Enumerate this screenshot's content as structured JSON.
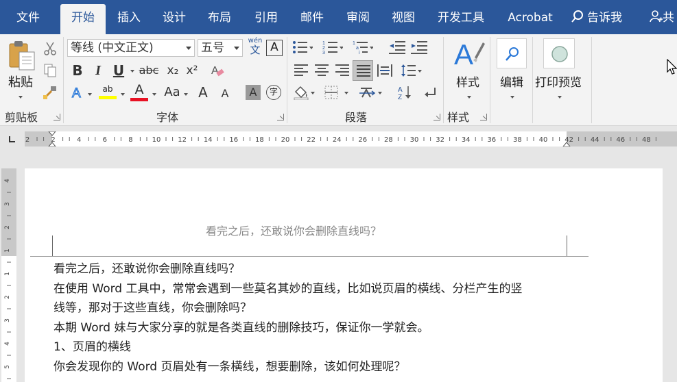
{
  "tabs": [
    {
      "label": "文件",
      "active": false
    },
    {
      "label": "开始",
      "active": true
    },
    {
      "label": "插入",
      "active": false
    },
    {
      "label": "设计",
      "active": false
    },
    {
      "label": "布局",
      "active": false
    },
    {
      "label": "引用",
      "active": false
    },
    {
      "label": "邮件",
      "active": false
    },
    {
      "label": "审阅",
      "active": false
    },
    {
      "label": "视图",
      "active": false
    },
    {
      "label": "开发工具",
      "active": false
    },
    {
      "label": "Acrobat",
      "active": false
    }
  ],
  "tell_me": "告诉我",
  "user_initial": "共",
  "ribbon": {
    "clipboard": {
      "label": "剪贴板",
      "paste": "粘贴"
    },
    "font": {
      "label": "字体",
      "font_name": "等线 (中文正文)",
      "font_size": "五号",
      "phonetic": "wén",
      "phonetic_char": "文",
      "border_char": "A",
      "bold": "B",
      "italic": "I",
      "underline": "U",
      "strike": "abc",
      "subscript": "x₂",
      "superscript": "x²",
      "grow": "A",
      "shrink": "A",
      "change_case": "Aa",
      "char_shade": "A",
      "enclose": "字",
      "highlight_text": "ab"
    },
    "paragraph": {
      "label": "段落"
    },
    "styles": {
      "label": "样式",
      "button": "样式"
    },
    "editing": {
      "button": "编辑"
    },
    "print_preview": {
      "button": "打印预览"
    }
  },
  "ruler_labels": [
    "2",
    "2",
    "4",
    "6",
    "8",
    "10",
    "12",
    "14",
    "16",
    "18",
    "20",
    "22",
    "24",
    "26",
    "28",
    "30",
    "32",
    "34",
    "36",
    "38",
    "40",
    "42",
    "44",
    "46",
    "48"
  ],
  "vruler_labels": [
    "4",
    "3",
    "2",
    "1",
    "1",
    "2",
    "3",
    "4",
    "5"
  ],
  "document": {
    "header": "看完之后，还敢说你会删除直线吗？",
    "lines": [
      "看完之后，还敢说你会删除直线吗？",
      "在使用 Word 工具中，常常会遇到一些莫名其妙的直线，比如说页眉的横线、分栏产生的竖",
      "线等，那对于这些直线，你会删除吗？",
      "本期 Word 妹与大家分享的就是各类直线的删除技巧，保证你一学就会。",
      "1、页眉的横线",
      "你会发现你的 Word 页眉处有一条横线，想要删除，该如何处理呢？"
    ]
  },
  "colors": {
    "brand": "#2b579a",
    "highlight": "#ffff00",
    "font_color": "#e81123"
  }
}
